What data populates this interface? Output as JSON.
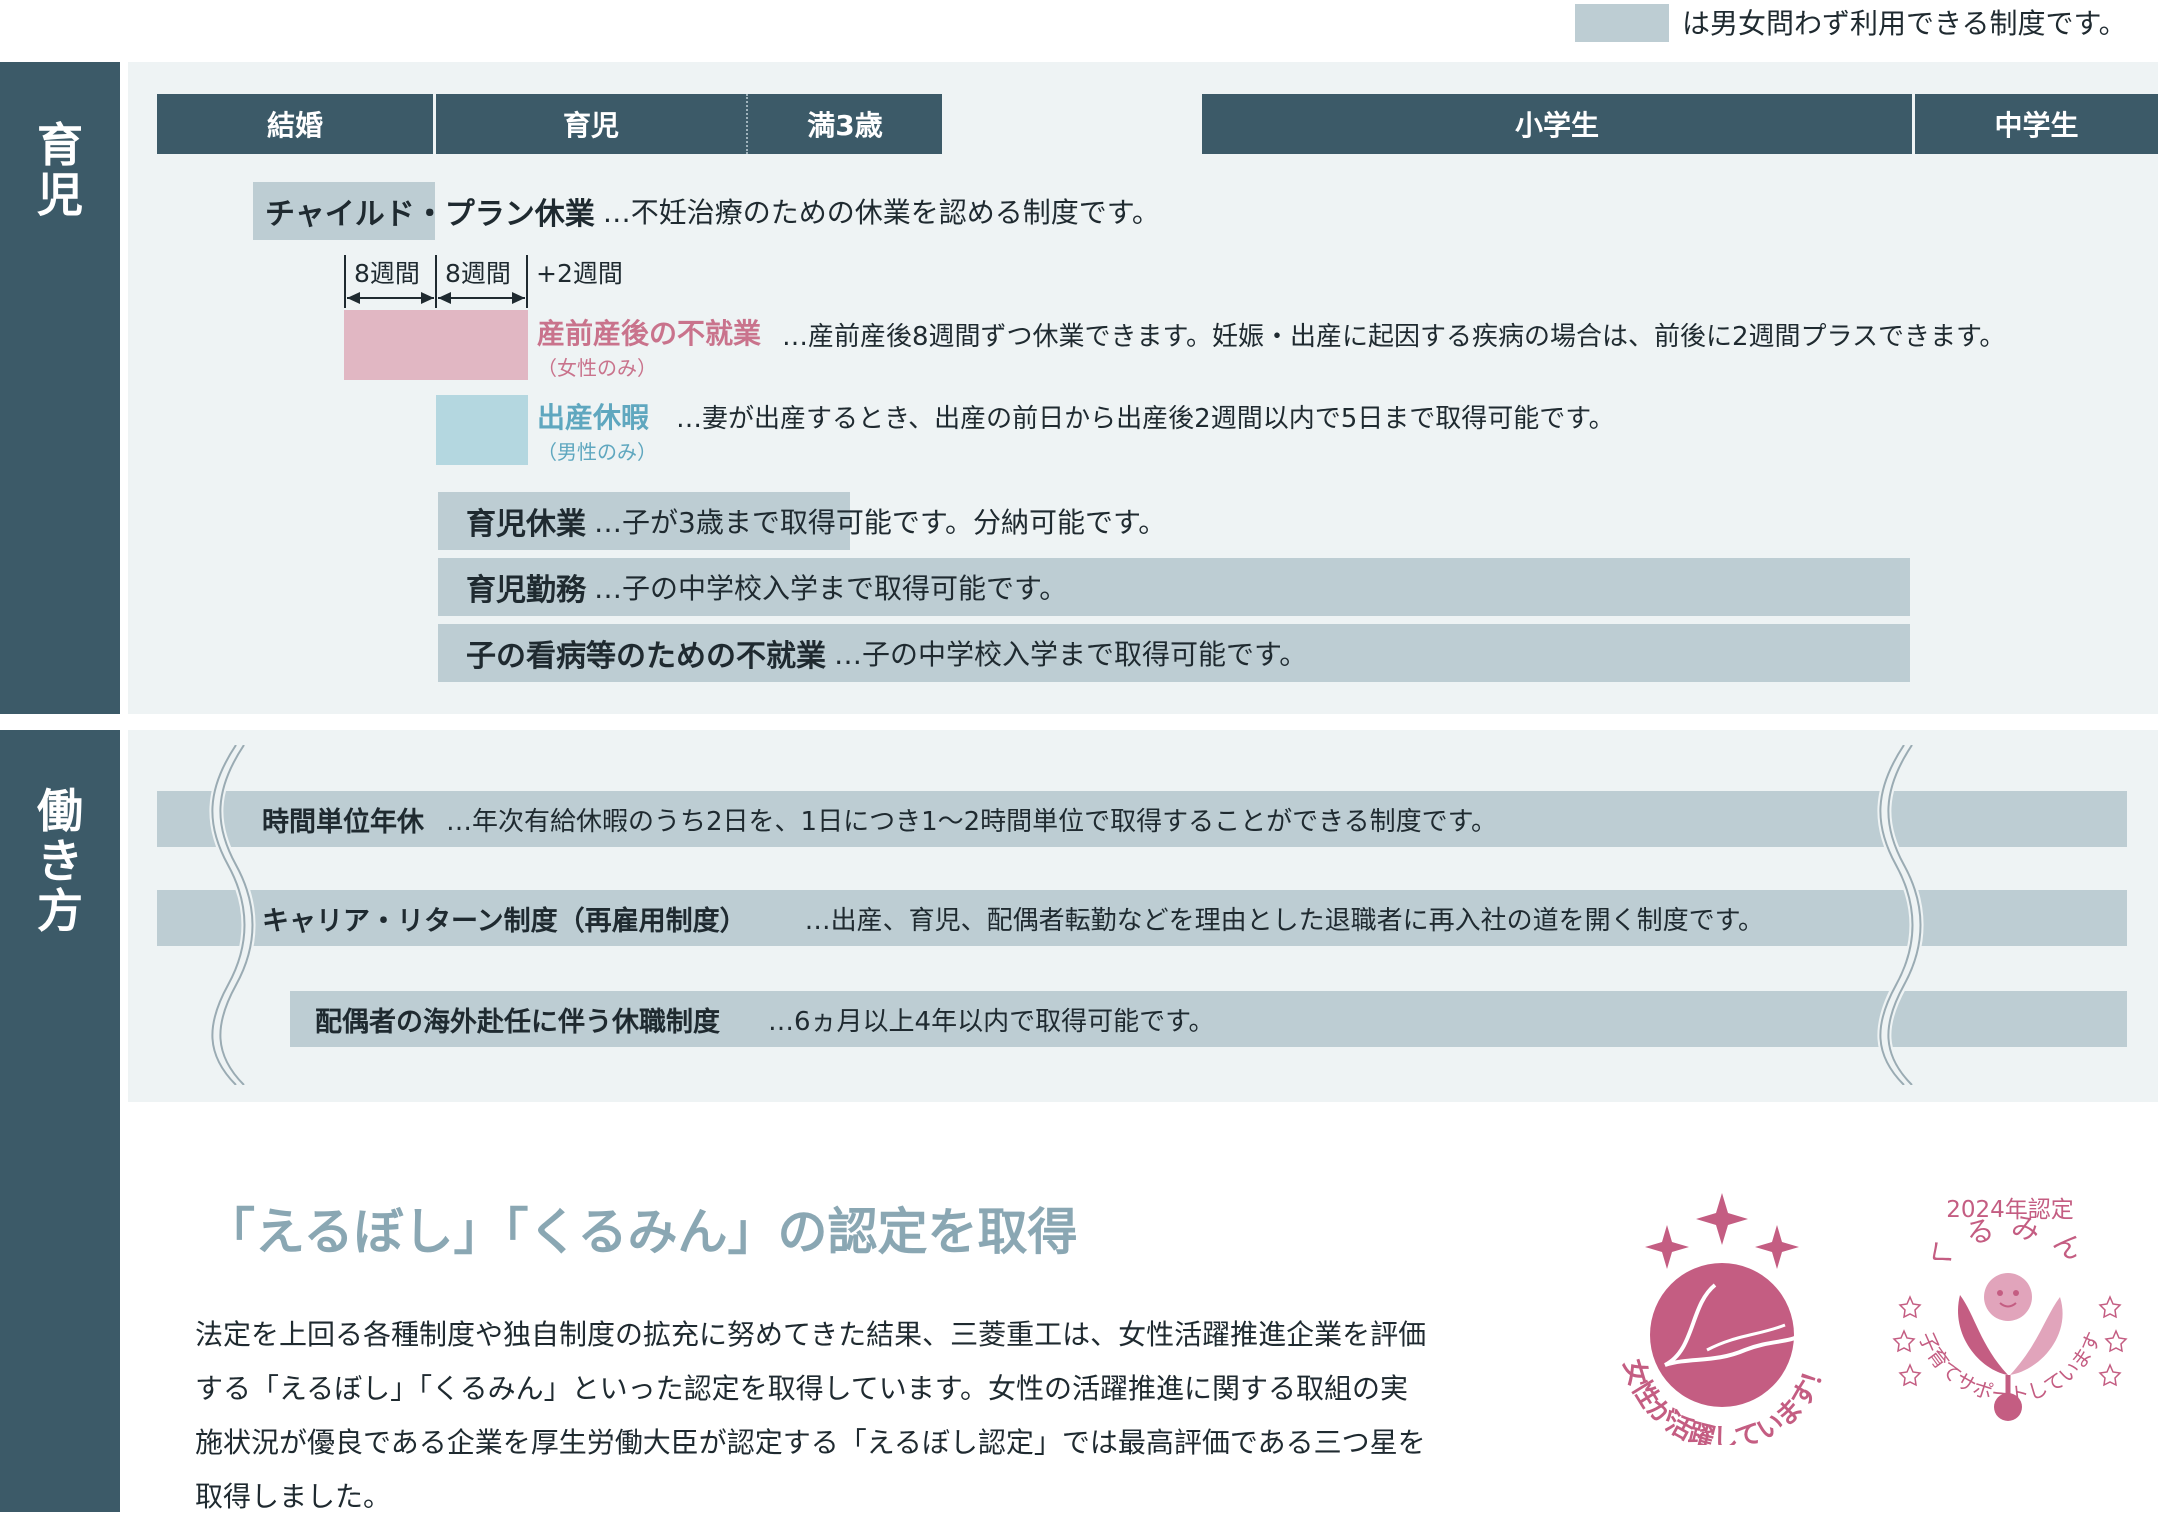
{
  "legend": {
    "text": "は男女問わず利用できる制度です。",
    "color": "#bdcdd3"
  },
  "sections": {
    "childcare": "育\n児",
    "work": "働\nき\n方"
  },
  "timeline": [
    "結婚",
    "育児",
    "満3歳",
    "小学生",
    "中学生"
  ],
  "childcare": {
    "child_plan": {
      "name": "チャイルド・プラン休業",
      "desc": "…不妊治療のための休業を認める制度です。"
    },
    "dims": [
      "8週間",
      "8週間",
      "+2週間"
    ],
    "maternity": {
      "name": "産前産後の不就業",
      "sub": "（女性のみ）",
      "desc": "…産前産後8週間ずつ休業できます。妊娠・出産に起因する疾病の場合は、前後に2週間プラスできます。",
      "color": "#e1b7c3",
      "text_color": "#c9738c"
    },
    "paternity": {
      "name": "出産休暇",
      "sub": "（男性のみ）",
      "desc": "…妻が出産するとき、出産の前日から出産後2週間以内で5日まで取得可能です。",
      "color": "#b4d7e0",
      "text_color": "#5fa7bf"
    },
    "leave": {
      "name": "育児休業",
      "desc": "…子が3歳まで取得可能です。分納可能です。"
    },
    "work_sched": {
      "name": "育児勤務",
      "desc": "…子の中学校入学まで取得可能です。"
    },
    "sick_child": {
      "name": "子の看病等のための不就業",
      "desc": "…子の中学校入学まで取得可能です。"
    }
  },
  "work": {
    "hourly": {
      "name": "時間単位年休",
      "desc": "…年次有給休暇のうち2日を、1日につき1〜2時間単位で取得することができる制度です。"
    },
    "career": {
      "name": "キャリア・リターン制度（再雇用制度）",
      "desc": "…出産、育児、配偶者転勤などを理由とした退職者に再入社の道を開く制度です。"
    },
    "spouse": {
      "name": "配偶者の海外赴任に伴う休職制度",
      "desc": "…6ヵ月以上4年以内で取得可能です。"
    }
  },
  "certification": {
    "title": "「えるぼし」「くるみん」の認定を取得",
    "body": [
      "法定を上回る各種制度や独自制度の拡充に努めてきた結果、三菱重工は、女性活躍推進企業を評価",
      "する「えるぼし」「くるみん」といった認定を取得しています。女性の活躍推進に関する取組の実",
      "施状況が優良である企業を厚生労働大臣が認定する「えるぼし認定」では最高評価である三つ星を",
      "取得しました。"
    ],
    "eruboshi_text": "女性が活躍しています！",
    "kurumin_year": "2024年認定",
    "kurumin_name": "くるみん",
    "kurumin_text": "子育てサポートしています",
    "title_color": "#8aa7b3",
    "badge_color": "#c45d82"
  }
}
